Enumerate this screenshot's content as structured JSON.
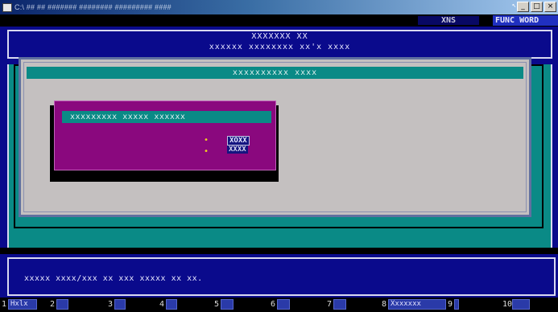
{
  "window": {
    "title": "C:\\ ## ## ####### ######## ######### ####",
    "controls": [
      "_",
      "□",
      "×"
    ],
    "caret_mark": "↖"
  },
  "status_bar": {
    "mode": "XNS",
    "func": "FUNC WORD"
  },
  "header": {
    "company": "XXXXXXX XX",
    "subtitle": "xxxxxx xxxxxxxx xx'x xxxx"
  },
  "main_panel": {
    "title": "xxxxxxxxxx xxxx"
  },
  "dialog": {
    "title": "xxxxxxxxx xxxxx xxxxxx",
    "option_yes": "XOXX",
    "option_no": "XXXX",
    "bullet": "•"
  },
  "message": {
    "text": "xxxxx xxxx/xxx xx xxx xxxxx xx xx."
  },
  "function_keys": [
    {
      "num": "1",
      "label": "Hxlx"
    },
    {
      "num": "2",
      "label": ""
    },
    {
      "num": "3",
      "label": ""
    },
    {
      "num": "4",
      "label": ""
    },
    {
      "num": "5",
      "label": ""
    },
    {
      "num": "6",
      "label": ""
    },
    {
      "num": "7",
      "label": ""
    },
    {
      "num": "8",
      "label": "Xxxxxxx"
    },
    {
      "num": "9",
      "label": ""
    },
    {
      "num": "10",
      "label": ""
    }
  ],
  "colors": {
    "desktop_blue": "#0a0a8c",
    "teal": "#0a8a86",
    "panel_gray": "#c4c0c0",
    "dialog_magenta": "#8a087e",
    "selection_blue": "#141480"
  }
}
